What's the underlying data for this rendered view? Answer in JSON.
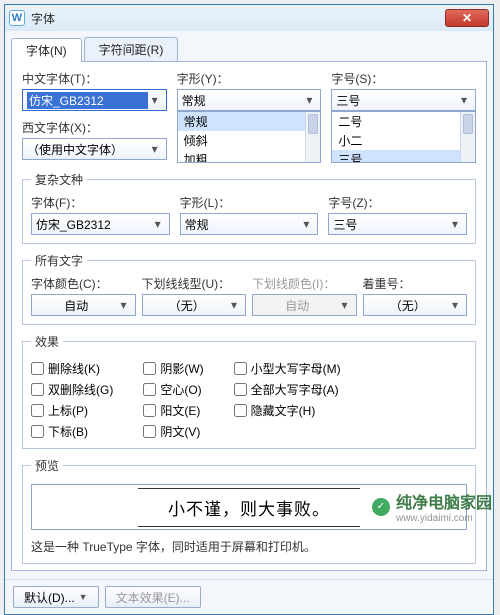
{
  "titlebar": {
    "appicon": "W",
    "title": "字体",
    "close": "✕"
  },
  "tabs": {
    "t0": "字体(N)",
    "t1": "字符间距(R)"
  },
  "cn": {
    "font_lbl": "中文字体(T)：",
    "font_val": "仿宋_GB2312",
    "style_lbl": "字形(Y)：",
    "style_val": "常规",
    "size_lbl": "字号(S)：",
    "size_val": "三号",
    "style_list": {
      "i0": "常规",
      "i1": "倾斜",
      "i2": "加粗"
    },
    "size_list": {
      "i0": "二号",
      "i1": "小二",
      "i2": "三号"
    }
  },
  "west": {
    "font_lbl": "西文字体(X)：",
    "font_val": "（使用中文字体）"
  },
  "complex": {
    "legend": "复杂文种",
    "font_lbl": "字体(F)：",
    "font_val": "仿宋_GB2312",
    "style_lbl": "字形(L)：",
    "style_val": "常规",
    "size_lbl": "字号(Z)：",
    "size_val": "三号"
  },
  "alltext": {
    "legend": "所有文字",
    "color_lbl": "字体颜色(C)：",
    "color_val": "自动",
    "ul_lbl": "下划线线型(U)：",
    "ul_val": "（无）",
    "ulc_lbl": "下划线颜色(I)：",
    "ulc_val": "自动",
    "em_lbl": "着重号：",
    "em_val": "（无）"
  },
  "effects": {
    "legend": "效果",
    "strike": "删除线(K)",
    "dstrike": "双删除线(G)",
    "sup": "上标(P)",
    "sub": "下标(B)",
    "shadow": "阴影(W)",
    "hollow": "空心(O)",
    "emboss": "阳文(E)",
    "engrave": "阴文(V)",
    "smallcaps": "小型大写字母(M)",
    "allcaps": "全部大写字母(A)",
    "hidden": "隐藏文字(H)"
  },
  "preview": {
    "legend": "预览",
    "sample": "小不谨，则大事败。"
  },
  "desc": "这是一种 TrueType 字体，同时适用于屏幕和打印机。",
  "footer": {
    "default": "默认(D)...",
    "texteffect": "文本效果(E)..."
  },
  "watermark": {
    "zh": "纯净电脑家园",
    "en": "www.yidaimi.com"
  }
}
